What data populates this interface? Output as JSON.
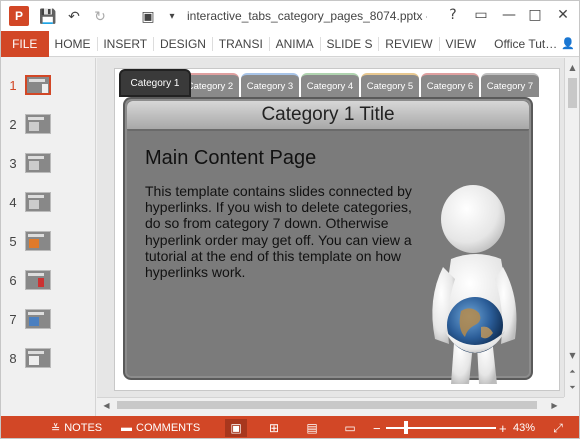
{
  "window": {
    "title": "interactive_tabs_category_pages_8074.pptx -",
    "app_icon": "P",
    "help_icon": "?",
    "restore_icon": "▭",
    "minimize_icon": "—",
    "maximize_icon": "□",
    "close_icon": "✕"
  },
  "qat": {
    "save_icon": "💾",
    "undo_icon": "↶",
    "redo_icon": "↻",
    "present_icon": "▣",
    "more_icon": "▾"
  },
  "ribbon": {
    "file": "FILE",
    "tabs": [
      "HOME",
      "INSERT",
      "DESIGN",
      "TRANSI",
      "ANIMA",
      "SLIDE S",
      "REVIEW",
      "VIEW"
    ],
    "account": "Office Tut…",
    "account_icon": "👤"
  },
  "thumbnails": {
    "active_index": 0,
    "items": [
      "1",
      "2",
      "3",
      "4",
      "5",
      "6",
      "7",
      "8"
    ]
  },
  "slide": {
    "tabs": [
      "Category 1",
      "Category 2",
      "Category 3",
      "Category 4",
      "Category 5",
      "Category 6",
      "Category 7"
    ],
    "title": "Category 1 Title",
    "heading": "Main Content Page",
    "body": "This template contains slides connected by hyperlinks.  If you wish to delete categories, do so from category 7 down.  Otherwise hyperlink order may get off.  You can view a tutorial at the end of this template on how hyperlinks work."
  },
  "status": {
    "notes": "NOTES",
    "comments": "COMMENTS",
    "zoom": "43%",
    "zoom_level": 0.43,
    "minus": "−",
    "plus": "+"
  },
  "colors": {
    "accent": "#d24726",
    "panel": "#7b7b7b",
    "tab_active": "#3a3a3a"
  }
}
